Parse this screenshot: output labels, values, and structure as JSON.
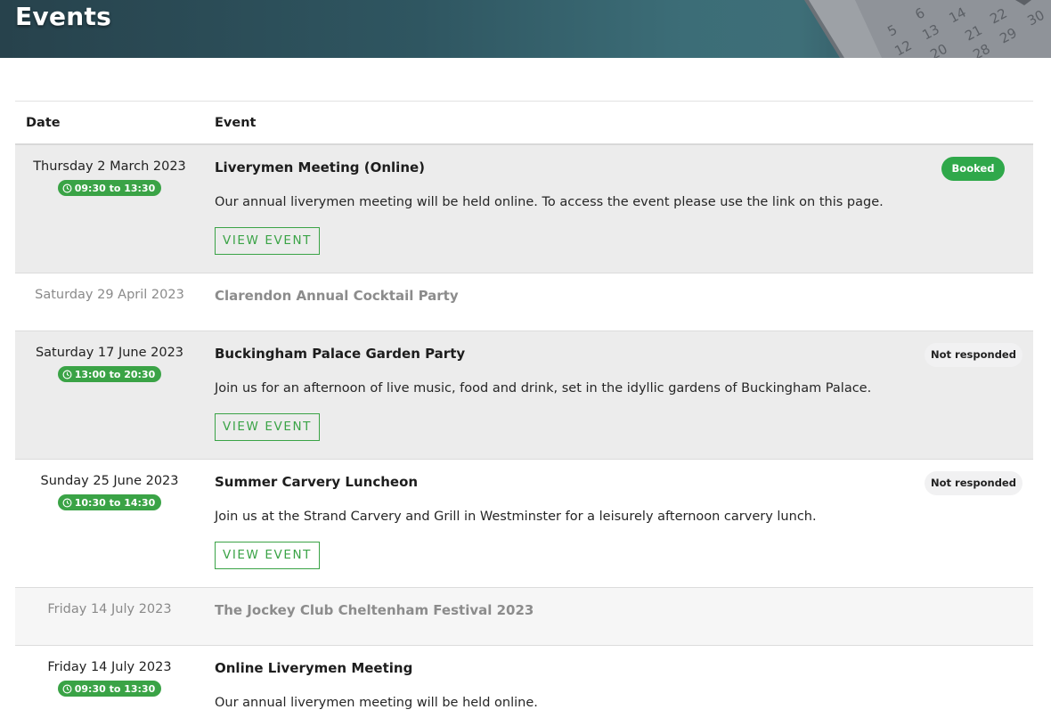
{
  "header": {
    "title": "Events",
    "calendar_numbers": [
      "5",
      "6",
      "12",
      "13",
      "14",
      "20",
      "21",
      "22",
      "28",
      "29",
      "30"
    ]
  },
  "table": {
    "col_date": "Date",
    "col_event": "Event"
  },
  "rows": [
    {
      "date": "Thursday 2 March 2023",
      "time": "09:30 to 13:30",
      "title": "Liverymen Meeting (Online)",
      "description": "Our annual liverymen meeting will be held online. To access the event please use the link on this page.",
      "button": "VIEW EVENT",
      "status": "Booked"
    },
    {
      "date": "Saturday 29 April 2023",
      "title": "Clarendon Annual Cocktail Party"
    },
    {
      "date": "Saturday 17 June 2023",
      "time": "13:00 to 20:30",
      "title": "Buckingham Palace Garden Party",
      "description": "Join us for an afternoon of live music, food and drink, set in the idyllic gardens of Buckingham Palace.",
      "button": "VIEW EVENT",
      "status": "Not responded"
    },
    {
      "date": "Sunday 25 June 2023",
      "time": "10:30 to 14:30",
      "title": "Summer Carvery Luncheon",
      "description": "Join us at the Strand Carvery and Grill in Westminster for a leisurely afternoon carvery lunch.",
      "button": "VIEW EVENT",
      "status": "Not responded"
    },
    {
      "date": "Friday 14 July 2023",
      "title": "The Jockey Club Cheltenham Festival 2023"
    },
    {
      "date": "Friday 14 July 2023",
      "time": "09:30 to 13:30",
      "title": "Online Liverymen Meeting",
      "description": "Our annual liverymen meeting will be held online."
    }
  ],
  "colors": {
    "accent_green": "#3aa346",
    "booked_green": "#2fa84a",
    "banner_teal": "#2f5661"
  }
}
